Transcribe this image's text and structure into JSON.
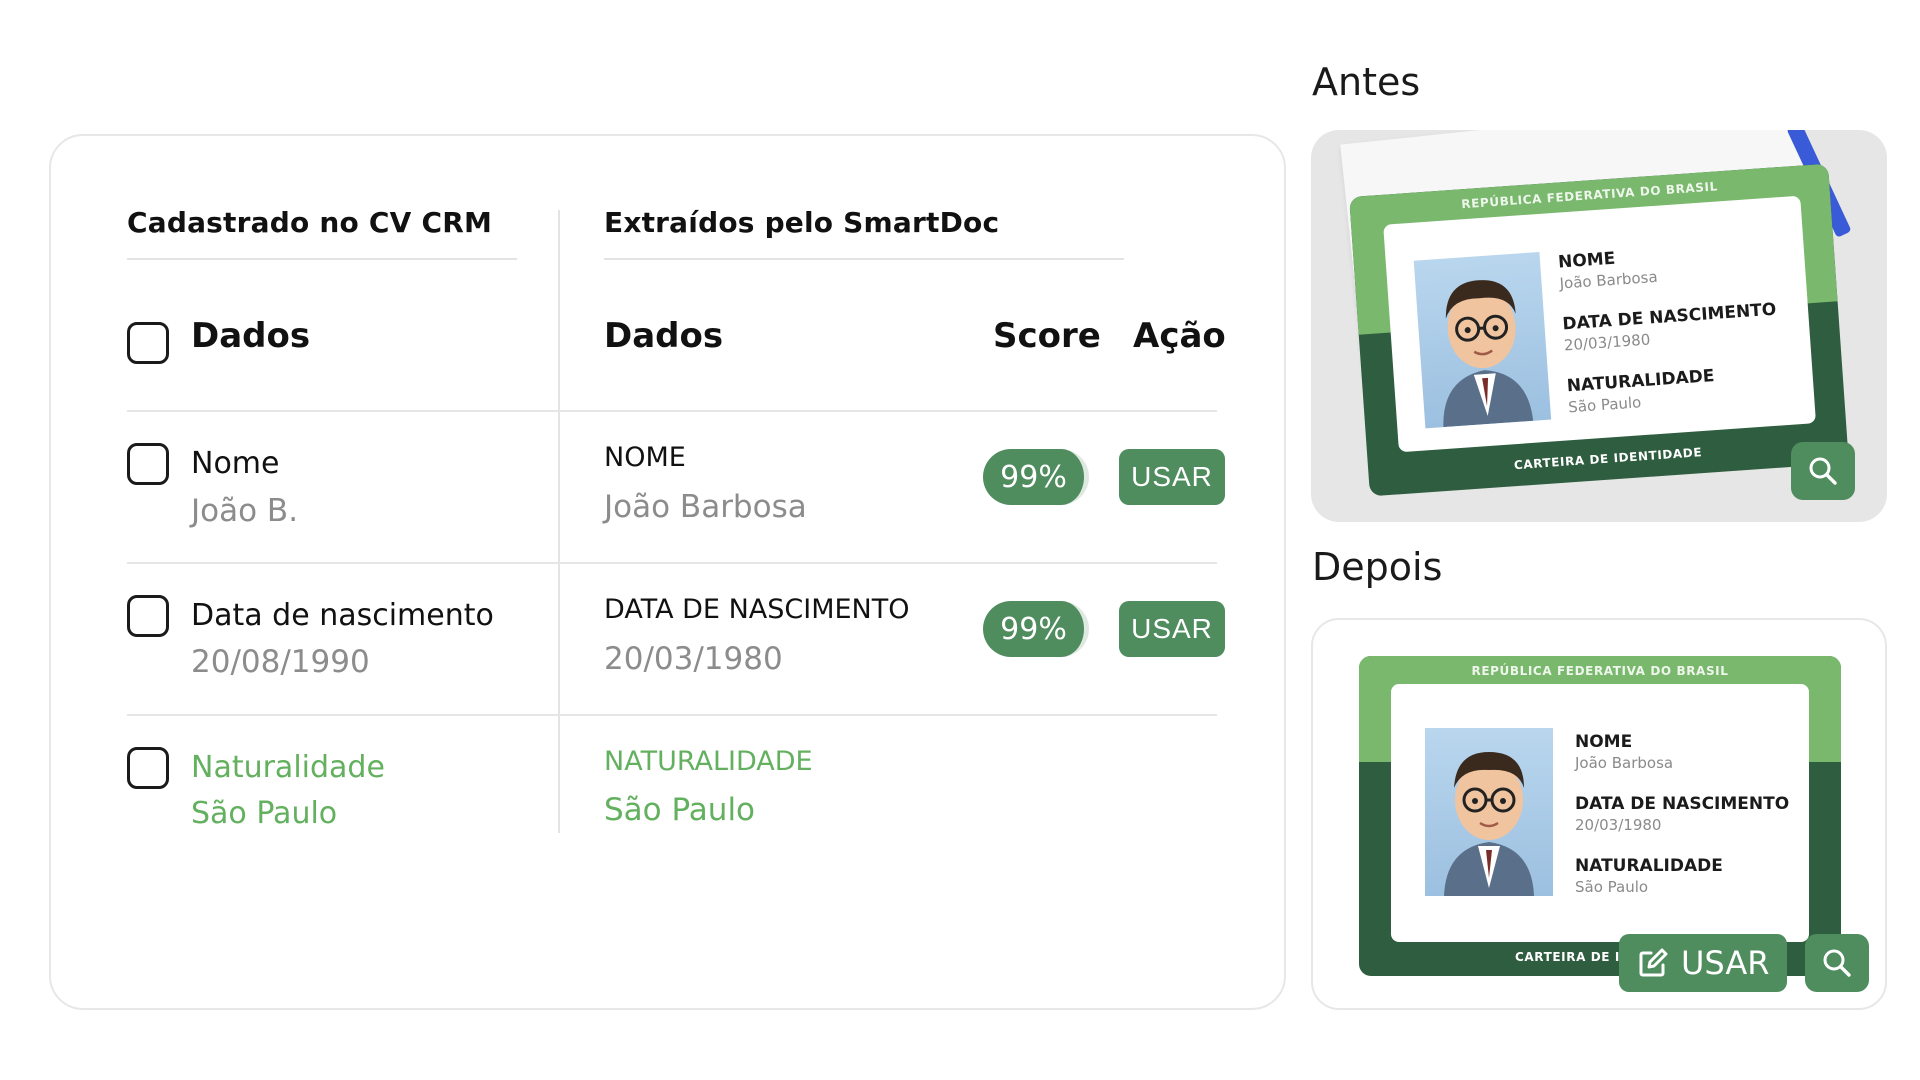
{
  "left_section": {
    "title": "Cadastrado no CV CRM",
    "column_header": "Dados"
  },
  "right_section": {
    "title": "Extraídos pelo SmartDoc",
    "col_dados": "Dados",
    "col_score": "Score",
    "col_acao": "Ação"
  },
  "rows": [
    {
      "crm_label": "Nome",
      "crm_value": "João B.",
      "doc_label": "NOME",
      "doc_value": "João Barbosa",
      "score": "99%",
      "action": "USAR"
    },
    {
      "crm_label": "Data de nascimento",
      "crm_value": "20/08/1990",
      "doc_label": "DATA DE NASCIMENTO",
      "doc_value": "20/03/1980",
      "score": "99%",
      "action": "USAR"
    },
    {
      "crm_label": "Naturalidade",
      "crm_value": "São Paulo",
      "doc_label": "NATURALIDADE",
      "doc_value": "São Paulo"
    }
  ],
  "before": {
    "title": "Antes"
  },
  "after": {
    "title": "Depois",
    "use_label": "USAR"
  },
  "id_card": {
    "header": "REPÚBLICA FEDERATIVA DO BRASIL",
    "footer": "CARTEIRA DE IDENTIDADE",
    "footer_truncated": "CARTEIRA DE ID",
    "name_label": "NOME",
    "name_value": "João Barbosa",
    "dob_label": "DATA DE NASCIMENTO",
    "dob_value": "20/03/1980",
    "birthplace_label": "NATURALIDADE",
    "birthplace_value": "São Paulo"
  },
  "colors": {
    "accent": "#4f8c5e",
    "highlight": "#63b05f",
    "card_light": "#79b86d",
    "card_dark": "#2f5d3f"
  },
  "icons": {
    "search": "search-icon",
    "edit": "edit-icon"
  }
}
